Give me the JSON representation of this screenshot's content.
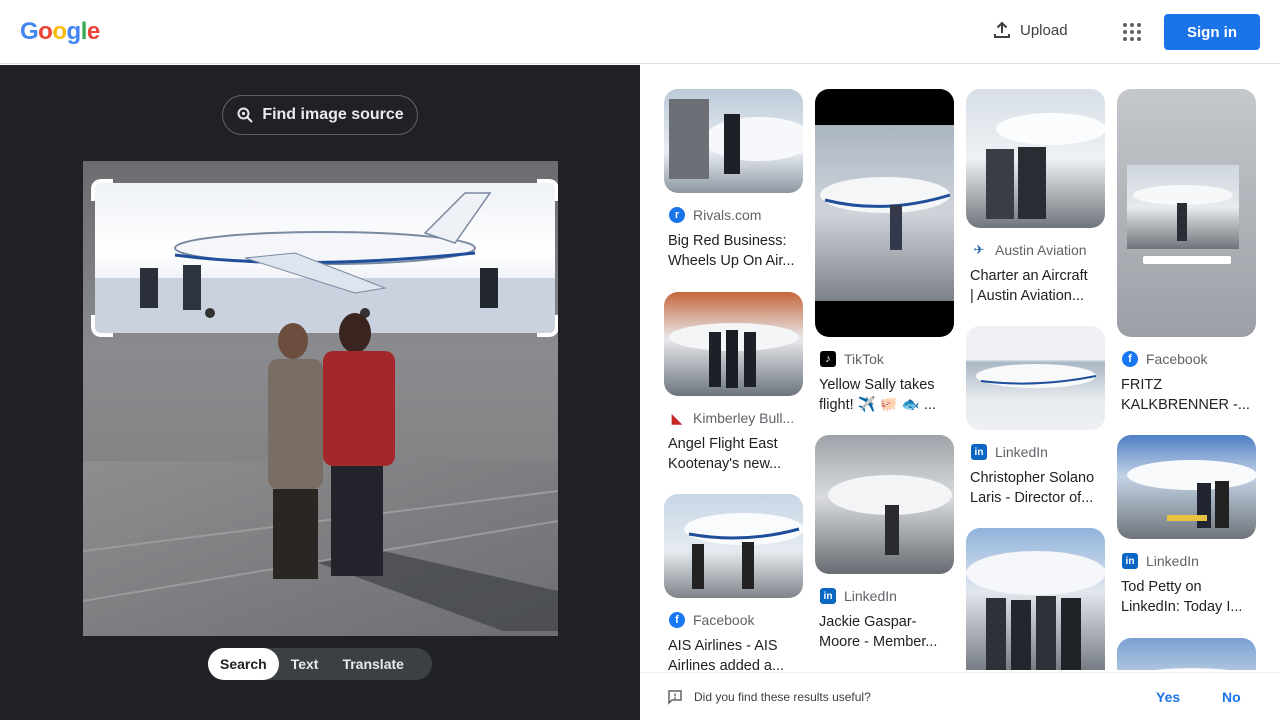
{
  "header": {
    "logo_letters": [
      {
        "ch": "G",
        "color": "#4285f4"
      },
      {
        "ch": "o",
        "color": "#ea4335"
      },
      {
        "ch": "o",
        "color": "#fbbc05"
      },
      {
        "ch": "g",
        "color": "#4285f4"
      },
      {
        "ch": "l",
        "color": "#34a853"
      },
      {
        "ch": "e",
        "color": "#ea4335"
      }
    ],
    "upload_label": "Upload",
    "signin_label": "Sign in"
  },
  "left": {
    "find_source_label": "Find image source",
    "modes": [
      "Search",
      "Text",
      "Translate"
    ],
    "active_mode": "Search"
  },
  "results": [
    {
      "source": "Rivals.com",
      "title": "Big Red Business:\nWheels Up On Air...",
      "favicon_color": "#1a73e8",
      "favicon_glyph": "r"
    },
    {
      "source": "Kimberley Bull...",
      "title": "Angel Flight East\nKootenay's new...",
      "favicon_color": "#c62828",
      "favicon_glyph": "◣"
    },
    {
      "source": "Facebook",
      "title": "AIS Airlines - AIS\nAirlines added a...",
      "favicon_color": "#1877f2",
      "favicon_glyph": "f"
    },
    {
      "source": "TikTok",
      "title": "Yellow Sally takes\nflight! ✈️ 🐖 🐟 ...",
      "favicon_color": "#000000",
      "favicon_glyph": "♪"
    },
    {
      "source": "LinkedIn",
      "title": "Jackie Gaspar-\nMoore - Member...",
      "favicon_color": "#0a66c2",
      "favicon_glyph": "in"
    },
    {
      "source": "Austin Aviation",
      "title": "Charter an Aircraft\n| Austin Aviation...",
      "favicon_color": "#2a64a8",
      "favicon_glyph": "✈"
    },
    {
      "source": "LinkedIn",
      "title": "Christopher Solano\nLaris - Director of...",
      "favicon_color": "#0a66c2",
      "favicon_glyph": "in"
    },
    {
      "source": "Facebook",
      "title": "FRITZ\nKALKBRENNER -...",
      "favicon_color": "#1877f2",
      "favicon_glyph": "f"
    },
    {
      "source": "LinkedIn",
      "title": "Tod Petty on\nLinkedIn: Today I...",
      "favicon_color": "#0a66c2",
      "favicon_glyph": "in"
    }
  ],
  "footer": {
    "question": "Did you find these results useful?",
    "yes_label": "Yes",
    "no_label": "No"
  }
}
